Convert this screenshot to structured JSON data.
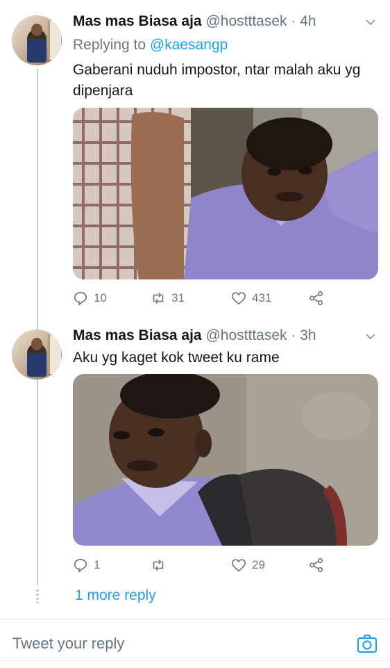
{
  "tweets": [
    {
      "name": "Mas mas Biasa aja",
      "handle": "@hostttasek",
      "separator": "·",
      "time": "4h",
      "reply_prefix": "Replying to",
      "reply_mention": "@kaesangp",
      "text": "Gaberani nuduh impostor, ntar malah aku yg dipenjara",
      "replies": "10",
      "retweets": "31",
      "likes": "431"
    },
    {
      "name": "Mas mas Biasa aja",
      "handle": "@hostttasek",
      "separator": "·",
      "time": "3h",
      "text": "Aku yg kaget kok tweet ku rame",
      "replies": "1",
      "retweets": "",
      "likes": "29"
    }
  ],
  "more_reply": "1 more reply",
  "reply_bar": {
    "placeholder": "Tweet your reply"
  },
  "icons": [
    "chevron-down-icon",
    "reply-icon",
    "retweet-icon",
    "like-icon",
    "share-icon",
    "camera-icon"
  ],
  "colors": {
    "accent": "#1da1f2",
    "secondary_text": "#657786",
    "thread_line": "#c4cfd6"
  }
}
